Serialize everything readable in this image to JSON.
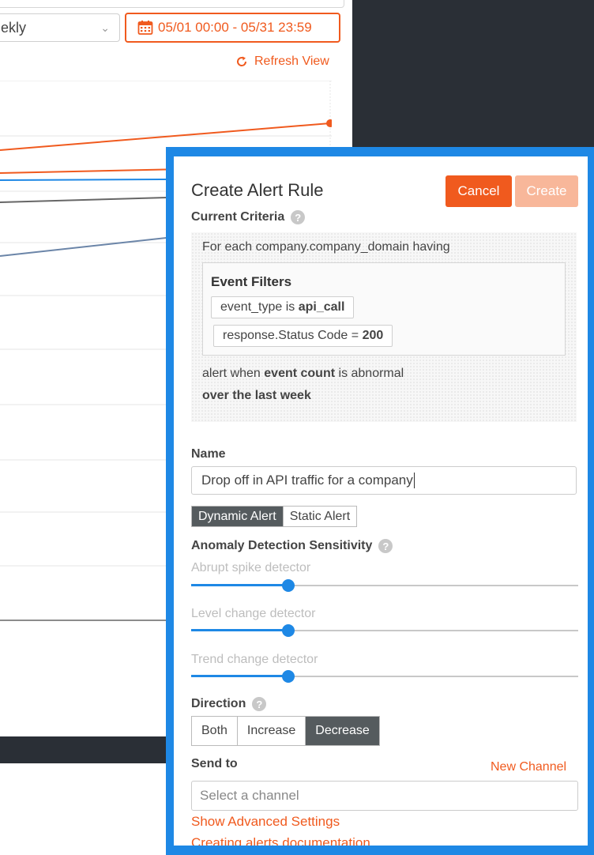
{
  "background": {
    "period_select": "ekly",
    "date_range": "05/01 00:00 - 05/31 23:59",
    "refresh": "Refresh View",
    "colors": {
      "accent": "#f05a1e",
      "line_blue": "#1e88e5",
      "line_gray": "#666666",
      "line_slate": "#6b85a8"
    }
  },
  "modal": {
    "title": "Create Alert Rule",
    "cancel_label": "Cancel",
    "create_label": "Create",
    "current_criteria_label": "Current Criteria",
    "criteria": {
      "for_each": "For each company.company_domain having",
      "event_filters_title": "Event Filters",
      "filter1": {
        "field": "event_type is ",
        "value": "api_call"
      },
      "filter2": {
        "field": "response.Status Code = ",
        "value": "200"
      },
      "alert_when_pre": "alert when ",
      "alert_when_bold": "event count",
      "alert_when_post": " is abnormal",
      "over_last": "over the last week"
    },
    "name_label": "Name",
    "name_value": "Drop off in API traffic for a company",
    "alert_types": [
      "Dynamic Alert",
      "Static Alert"
    ],
    "active_alert_type": "Dynamic Alert",
    "sensitivity_label": "Anomaly Detection Sensitivity",
    "sliders": [
      {
        "label": "Abrupt spike detector",
        "level": 0.25
      },
      {
        "label": "Level change detector",
        "level": 0.25
      },
      {
        "label": "Trend change detector",
        "level": 0.25
      }
    ],
    "direction_label": "Direction",
    "directions": [
      "Both",
      "Increase",
      "Decrease"
    ],
    "active_direction": "Decrease",
    "send_to_label": "Send to",
    "new_channel": "New Channel",
    "channel_placeholder": "Select a channel",
    "advanced_link": "Show Advanced Settings",
    "docs_link": "Creating alerts documentation"
  }
}
